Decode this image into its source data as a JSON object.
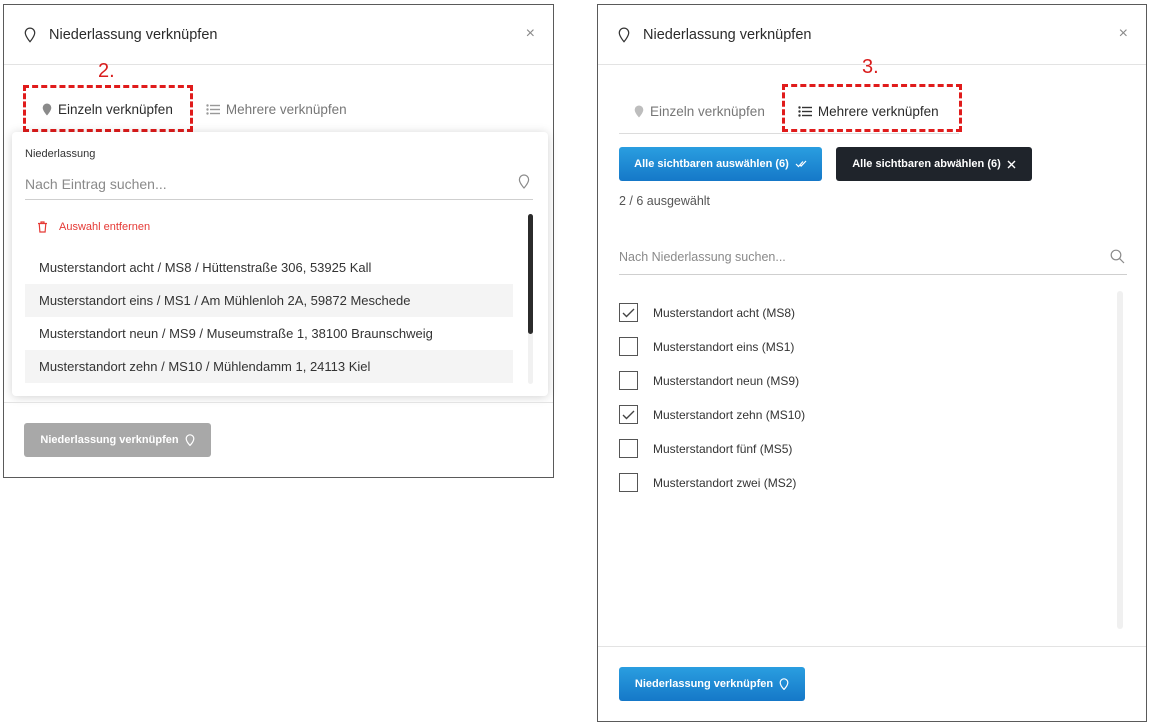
{
  "left_dialog": {
    "title": "Niederlassung verknüpfen",
    "close": "×",
    "annotation": "2.",
    "tabs": [
      {
        "label": "Einzeln verknüpfen",
        "icon": "location-pin-icon",
        "active": true
      },
      {
        "label": "Mehrere verknüpfen",
        "icon": "list-icon",
        "active": false
      }
    ],
    "field_label": "Niederlassung",
    "field_placeholder": "Nach Eintrag suchen...",
    "remove_label": "Auswahl entfernen",
    "options": [
      "Musterstandort acht / MS8 / Hüttenstraße 306, 53925 Kall",
      "Musterstandort eins / MS1 / Am Mühlenloh 2A, 59872 Meschede",
      "Musterstandort neun / MS9 / Museumstraße 1, 38100 Braunschweig",
      "Musterstandort zehn / MS10 / Mühlendamm 1, 24113 Kiel"
    ],
    "submit_label": "Niederlassung verknüpfen"
  },
  "right_dialog": {
    "title": "Niederlassung verknüpfen",
    "close": "×",
    "annotation": "3.",
    "tabs": [
      {
        "label": "Einzeln verknüpfen",
        "icon": "location-pin-icon",
        "active": false
      },
      {
        "label": "Mehrere verknüpfen",
        "icon": "list-icon",
        "active": true
      }
    ],
    "select_all_label": "Alle sichtbaren auswählen (6)",
    "deselect_all_label": "Alle sichtbaren abwählen (6)",
    "selection_count": "2 / 6 ausgewählt",
    "search_placeholder": "Nach Niederlassung suchen...",
    "items": [
      {
        "label": "Musterstandort acht (MS8)",
        "checked": true
      },
      {
        "label": "Musterstandort eins (MS1)",
        "checked": false
      },
      {
        "label": "Musterstandort neun (MS9)",
        "checked": false
      },
      {
        "label": "Musterstandort zehn (MS10)",
        "checked": true
      },
      {
        "label": "Musterstandort fünf (MS5)",
        "checked": false
      },
      {
        "label": "Musterstandort zwei (MS2)",
        "checked": false
      }
    ],
    "submit_label": "Niederlassung verknüpfen"
  },
  "colors": {
    "annotation": "#e01b1b",
    "primary_blue": "#1e88d4",
    "dark_button": "#1f242b",
    "danger": "#e53935",
    "disabled": "#a8a8a8"
  }
}
